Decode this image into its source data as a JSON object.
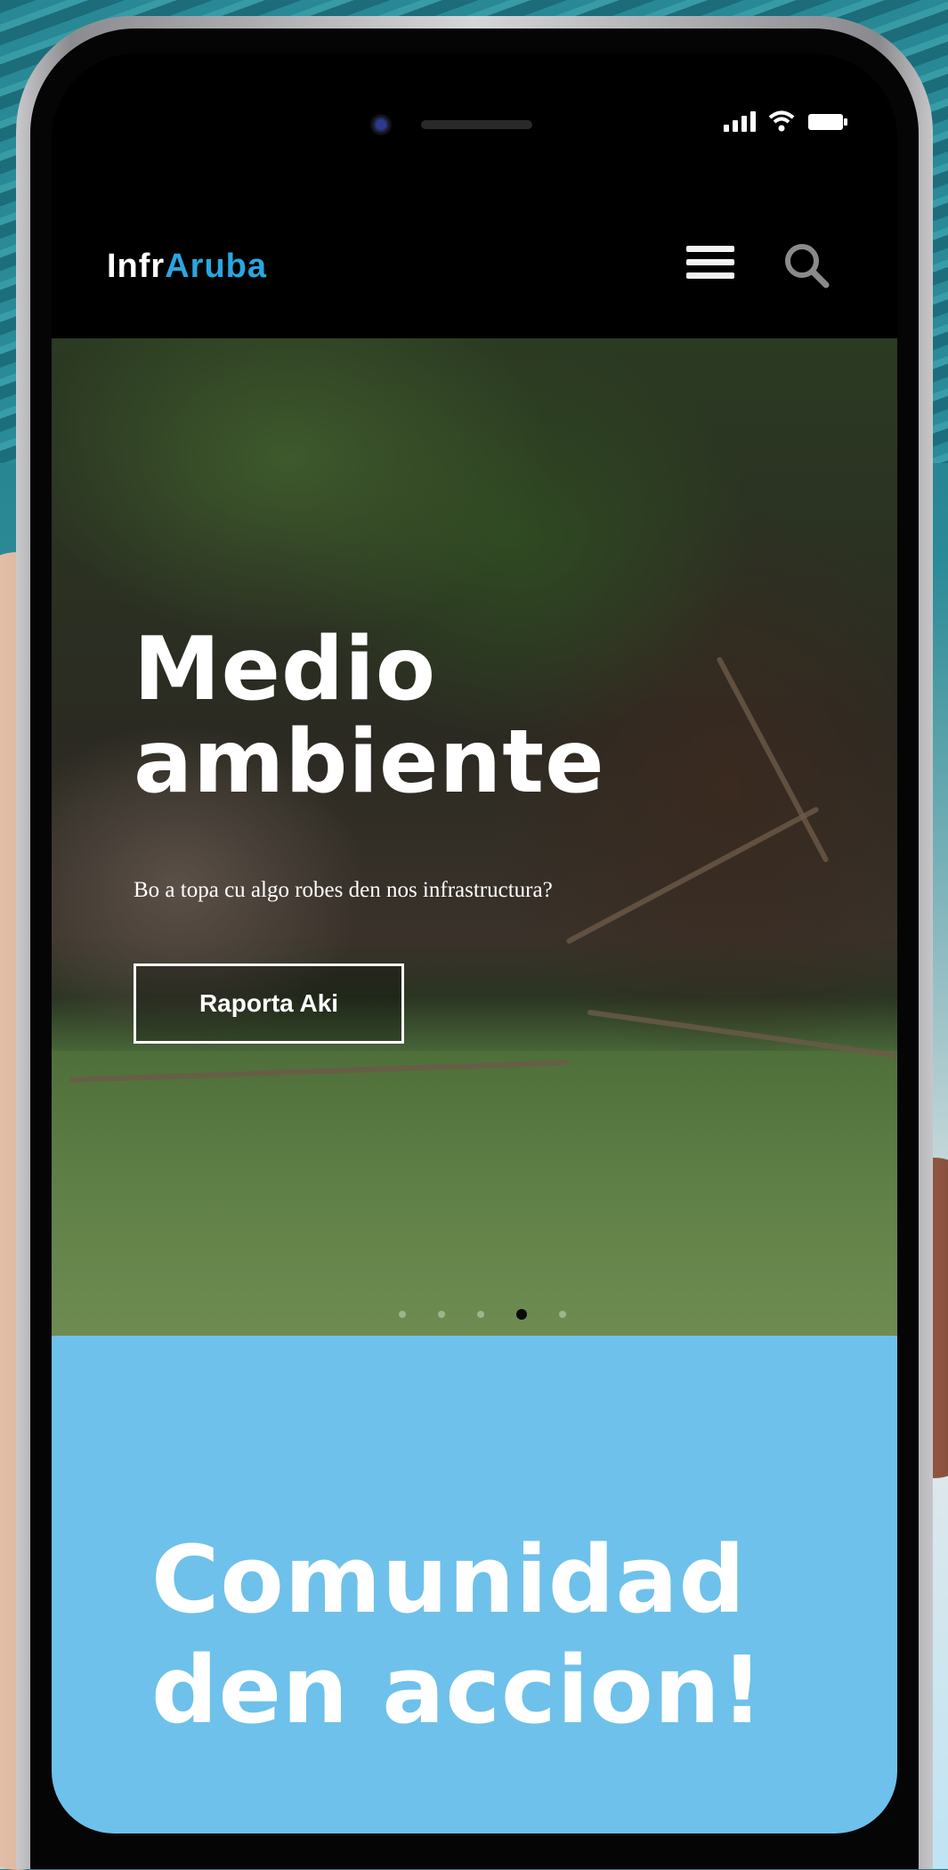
{
  "header": {
    "logo_part1": "Infr",
    "logo_part2": "Aruba",
    "logo_accent_color": "#2aa6e0"
  },
  "icons": {
    "menu": "hamburger-menu-icon",
    "search": "search-icon",
    "signal": "signal-icon",
    "wifi": "wifi-icon",
    "battery": "battery-icon"
  },
  "hero": {
    "title_line1": "Medio",
    "title_line2": "ambiente",
    "subtitle": "Bo a topa cu algo robes den nos infrastructura?",
    "button_label": "Raporta Aki",
    "carousel_count": 5,
    "carousel_active": 4
  },
  "community": {
    "title_line1": "Comunidad",
    "title_line2": "den accion!",
    "background_color": "#6ec1ea"
  }
}
